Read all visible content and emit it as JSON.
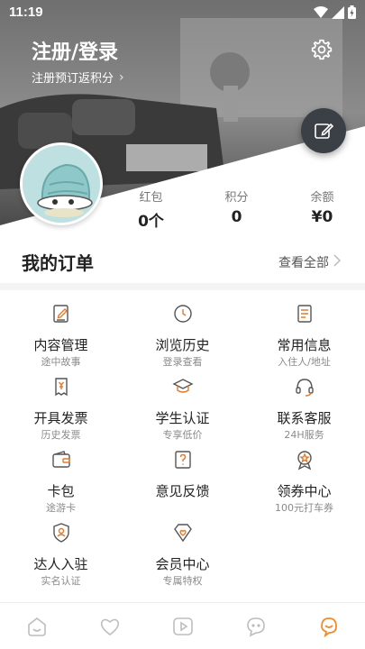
{
  "status_bar": {
    "time": "11:19"
  },
  "header": {
    "title": "注册/登录",
    "subtitle": "注册预订返积分",
    "subtitle_chevron": "›"
  },
  "stats": [
    {
      "label": "红包",
      "value": "0个"
    },
    {
      "label": "积分",
      "value": "0"
    },
    {
      "label": "余额",
      "value": "¥0"
    }
  ],
  "orders": {
    "title": "我的订单",
    "view_all": "查看全部"
  },
  "grid": [
    {
      "title": "内容管理",
      "sub": "途中故事",
      "icon": "edit-note-icon"
    },
    {
      "title": "浏览历史",
      "sub": "登录查看",
      "icon": "clock-icon"
    },
    {
      "title": "常用信息",
      "sub": "入住人/地址",
      "icon": "document-list-icon"
    },
    {
      "title": "开具发票",
      "sub": "历史发票",
      "icon": "invoice-icon"
    },
    {
      "title": "学生认证",
      "sub": "专享低价",
      "icon": "graduation-cap-icon"
    },
    {
      "title": "联系客服",
      "sub": "24H服务",
      "icon": "headset-icon"
    },
    {
      "title": "卡包",
      "sub": "途游卡",
      "icon": "wallet-icon"
    },
    {
      "title": "意见反馈",
      "sub": "",
      "icon": "feedback-icon"
    },
    {
      "title": "领券中心",
      "sub": "100元打车券",
      "icon": "badge-star-icon"
    },
    {
      "title": "达人入驻",
      "sub": "实名认证",
      "icon": "person-shield-icon"
    },
    {
      "title": "会员中心",
      "sub": "专属特权",
      "icon": "diamond-heart-icon"
    }
  ],
  "colors": {
    "accent": "#f08c2c",
    "icon_gray": "#bdbdbd",
    "icon_orange": "#e07b2e"
  },
  "tabs": [
    {
      "icon": "home-icon",
      "active": false
    },
    {
      "icon": "heart-icon",
      "active": false
    },
    {
      "icon": "play-icon",
      "active": false
    },
    {
      "icon": "chat-icon",
      "active": false
    },
    {
      "icon": "profile-icon",
      "active": true
    }
  ]
}
